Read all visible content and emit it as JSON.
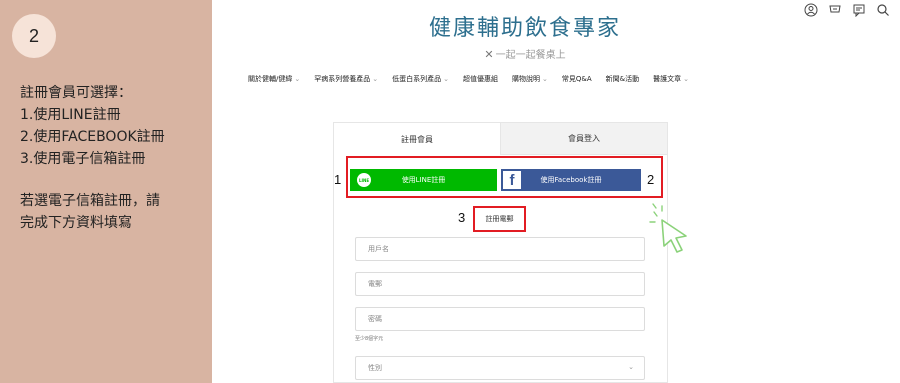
{
  "step": {
    "number": "2"
  },
  "instructions": {
    "lines": [
      "註冊會員可選擇：",
      "1.使用LINE註冊",
      "2.使用FACEBOOK註冊",
      "3.使用電子信箱註冊"
    ],
    "note_lines": [
      "若選電子信箱註冊，請",
      "完成下方資料填寫"
    ]
  },
  "brand": {
    "title": "健康輔助飲食專家",
    "subtitle": "一起一起餐桌上"
  },
  "header_icons": [
    "user-icon",
    "cart-icon",
    "chat-icon",
    "search-icon"
  ],
  "nav": {
    "items": [
      {
        "label": "關於健輔/健緯",
        "chevron": "⌄"
      },
      {
        "label": "罕病系列營養產品",
        "chevron": "⌄"
      },
      {
        "label": "低蛋白系列產品",
        "chevron": "⌄"
      },
      {
        "label": "超值優惠組",
        "chevron": ""
      },
      {
        "label": "購物說明",
        "chevron": "⌄"
      },
      {
        "label": "常見Q&A",
        "chevron": ""
      },
      {
        "label": "新聞&活動",
        "chevron": ""
      },
      {
        "label": "醫護文章",
        "chevron": "⌄"
      }
    ]
  },
  "form": {
    "tabs": {
      "register": "註冊會員",
      "login": "會員登入"
    },
    "line_button": "使用LINE註冊",
    "line_logo": "LINE",
    "fb_button": "使用Facebook註冊",
    "fb_logo": "f",
    "email_register": "註冊電郵",
    "fields": {
      "username": "用戶名",
      "email": "電郵",
      "password": "密碼",
      "password_hint": "至少8個字元",
      "gender": "性別"
    },
    "callout_numbers": {
      "one": "1",
      "two": "2",
      "three": "3"
    }
  },
  "colors": {
    "panel": "#d8b4a2",
    "line_green": "#00b900",
    "facebook_blue": "#3b5998",
    "highlight_red": "#e21c23",
    "brand_blue": "#2d6f8e"
  }
}
